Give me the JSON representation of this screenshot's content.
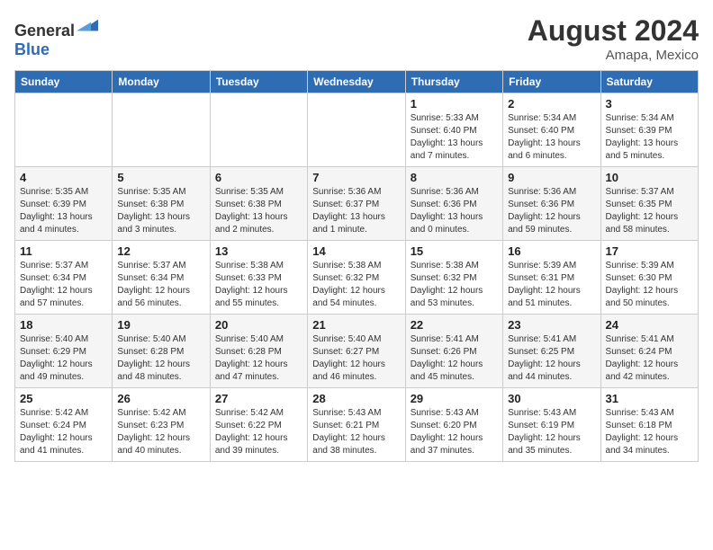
{
  "header": {
    "logo_general": "General",
    "logo_blue": "Blue",
    "month_year": "August 2024",
    "location": "Amapa, Mexico"
  },
  "days_of_week": [
    "Sunday",
    "Monday",
    "Tuesday",
    "Wednesday",
    "Thursday",
    "Friday",
    "Saturday"
  ],
  "weeks": [
    [
      {
        "day": "",
        "info": ""
      },
      {
        "day": "",
        "info": ""
      },
      {
        "day": "",
        "info": ""
      },
      {
        "day": "",
        "info": ""
      },
      {
        "day": "1",
        "info": "Sunrise: 5:33 AM\nSunset: 6:40 PM\nDaylight: 13 hours and 7 minutes."
      },
      {
        "day": "2",
        "info": "Sunrise: 5:34 AM\nSunset: 6:40 PM\nDaylight: 13 hours and 6 minutes."
      },
      {
        "day": "3",
        "info": "Sunrise: 5:34 AM\nSunset: 6:39 PM\nDaylight: 13 hours and 5 minutes."
      }
    ],
    [
      {
        "day": "4",
        "info": "Sunrise: 5:35 AM\nSunset: 6:39 PM\nDaylight: 13 hours and 4 minutes."
      },
      {
        "day": "5",
        "info": "Sunrise: 5:35 AM\nSunset: 6:38 PM\nDaylight: 13 hours and 3 minutes."
      },
      {
        "day": "6",
        "info": "Sunrise: 5:35 AM\nSunset: 6:38 PM\nDaylight: 13 hours and 2 minutes."
      },
      {
        "day": "7",
        "info": "Sunrise: 5:36 AM\nSunset: 6:37 PM\nDaylight: 13 hours and 1 minute."
      },
      {
        "day": "8",
        "info": "Sunrise: 5:36 AM\nSunset: 6:36 PM\nDaylight: 13 hours and 0 minutes."
      },
      {
        "day": "9",
        "info": "Sunrise: 5:36 AM\nSunset: 6:36 PM\nDaylight: 12 hours and 59 minutes."
      },
      {
        "day": "10",
        "info": "Sunrise: 5:37 AM\nSunset: 6:35 PM\nDaylight: 12 hours and 58 minutes."
      }
    ],
    [
      {
        "day": "11",
        "info": "Sunrise: 5:37 AM\nSunset: 6:34 PM\nDaylight: 12 hours and 57 minutes."
      },
      {
        "day": "12",
        "info": "Sunrise: 5:37 AM\nSunset: 6:34 PM\nDaylight: 12 hours and 56 minutes."
      },
      {
        "day": "13",
        "info": "Sunrise: 5:38 AM\nSunset: 6:33 PM\nDaylight: 12 hours and 55 minutes."
      },
      {
        "day": "14",
        "info": "Sunrise: 5:38 AM\nSunset: 6:32 PM\nDaylight: 12 hours and 54 minutes."
      },
      {
        "day": "15",
        "info": "Sunrise: 5:38 AM\nSunset: 6:32 PM\nDaylight: 12 hours and 53 minutes."
      },
      {
        "day": "16",
        "info": "Sunrise: 5:39 AM\nSunset: 6:31 PM\nDaylight: 12 hours and 51 minutes."
      },
      {
        "day": "17",
        "info": "Sunrise: 5:39 AM\nSunset: 6:30 PM\nDaylight: 12 hours and 50 minutes."
      }
    ],
    [
      {
        "day": "18",
        "info": "Sunrise: 5:40 AM\nSunset: 6:29 PM\nDaylight: 12 hours and 49 minutes."
      },
      {
        "day": "19",
        "info": "Sunrise: 5:40 AM\nSunset: 6:28 PM\nDaylight: 12 hours and 48 minutes."
      },
      {
        "day": "20",
        "info": "Sunrise: 5:40 AM\nSunset: 6:28 PM\nDaylight: 12 hours and 47 minutes."
      },
      {
        "day": "21",
        "info": "Sunrise: 5:40 AM\nSunset: 6:27 PM\nDaylight: 12 hours and 46 minutes."
      },
      {
        "day": "22",
        "info": "Sunrise: 5:41 AM\nSunset: 6:26 PM\nDaylight: 12 hours and 45 minutes."
      },
      {
        "day": "23",
        "info": "Sunrise: 5:41 AM\nSunset: 6:25 PM\nDaylight: 12 hours and 44 minutes."
      },
      {
        "day": "24",
        "info": "Sunrise: 5:41 AM\nSunset: 6:24 PM\nDaylight: 12 hours and 42 minutes."
      }
    ],
    [
      {
        "day": "25",
        "info": "Sunrise: 5:42 AM\nSunset: 6:24 PM\nDaylight: 12 hours and 41 minutes."
      },
      {
        "day": "26",
        "info": "Sunrise: 5:42 AM\nSunset: 6:23 PM\nDaylight: 12 hours and 40 minutes."
      },
      {
        "day": "27",
        "info": "Sunrise: 5:42 AM\nSunset: 6:22 PM\nDaylight: 12 hours and 39 minutes."
      },
      {
        "day": "28",
        "info": "Sunrise: 5:43 AM\nSunset: 6:21 PM\nDaylight: 12 hours and 38 minutes."
      },
      {
        "day": "29",
        "info": "Sunrise: 5:43 AM\nSunset: 6:20 PM\nDaylight: 12 hours and 37 minutes."
      },
      {
        "day": "30",
        "info": "Sunrise: 5:43 AM\nSunset: 6:19 PM\nDaylight: 12 hours and 35 minutes."
      },
      {
        "day": "31",
        "info": "Sunrise: 5:43 AM\nSunset: 6:18 PM\nDaylight: 12 hours and 34 minutes."
      }
    ]
  ]
}
